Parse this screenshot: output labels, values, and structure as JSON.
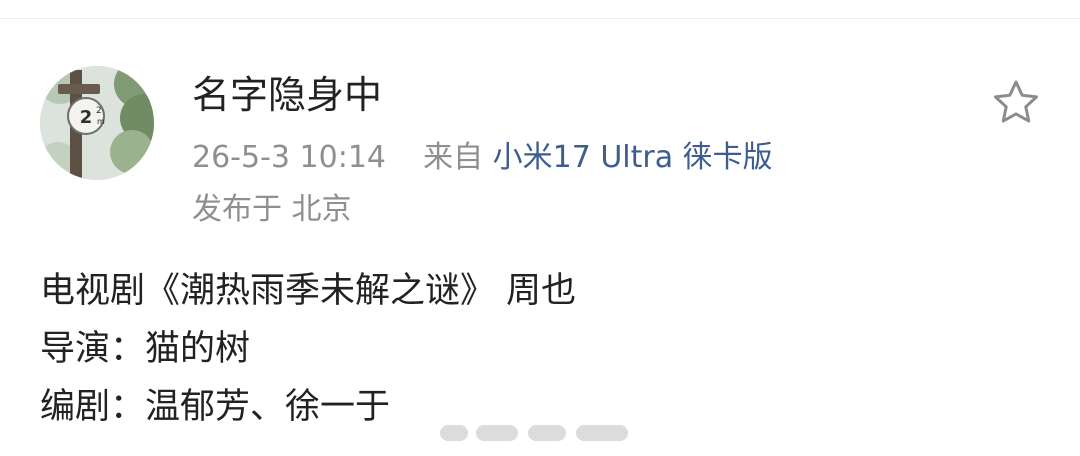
{
  "post": {
    "author": {
      "name": "名字隐身中"
    },
    "meta": {
      "time": "26-5-3 10:14",
      "from_label": "来自",
      "source": "小米17 Ultra 徕卡版",
      "location": "发布于 北京"
    },
    "content": {
      "lines": [
        "电视剧《潮热雨季未解之谜》 周也",
        "导演：猫的树",
        "编剧：温郁芳、徐一于"
      ]
    },
    "icons": {
      "favorite": "star-icon"
    }
  },
  "colors": {
    "text": "#222222",
    "meta": "#8f8f8f",
    "link": "#3d5d8e",
    "divider": "#ececec"
  }
}
